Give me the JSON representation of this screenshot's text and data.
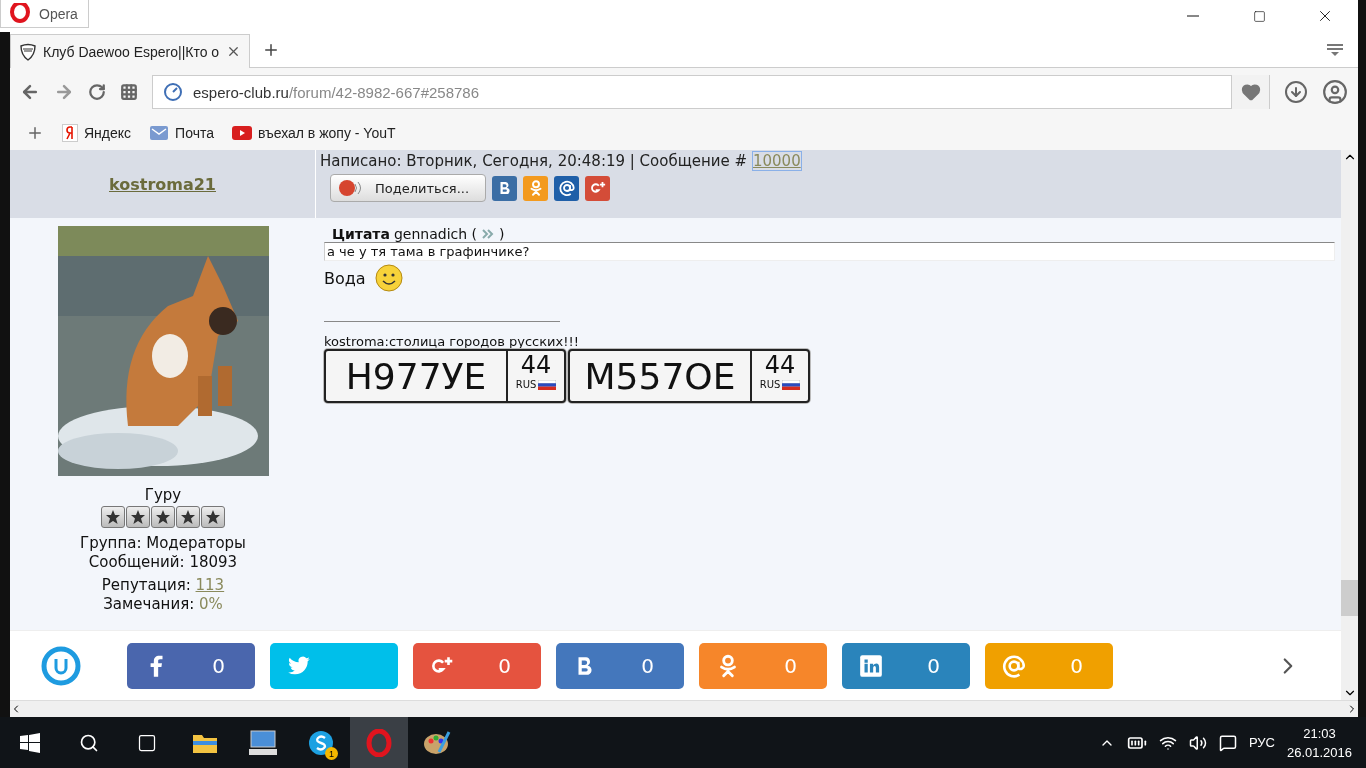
{
  "window": {
    "title": "Opera"
  },
  "tabs": [
    {
      "label": "Клуб Daewoo Espero||Кто о",
      "selected": true
    }
  ],
  "address": {
    "host": "espero-club.ru",
    "path": "/forum/42-8982-667#258786"
  },
  "bookmarks": [
    {
      "kind": "yandex",
      "label": "Яндекс"
    },
    {
      "kind": "mail",
      "label": "Почта"
    },
    {
      "kind": "youtube",
      "label": "въехал в жопу - YouT"
    }
  ],
  "post": {
    "author": "kostroma21",
    "written": "Написано: Вторник, Сегодня, 20:48:19 | Сообщение #",
    "number": "10000",
    "share_label": "Поделиться...",
    "share_icons": [
      {
        "kind": "vk",
        "color": "#3b6ea5"
      },
      {
        "kind": "ok",
        "color": "#f39a1e"
      },
      {
        "kind": "mail",
        "color": "#1f5fa8"
      },
      {
        "kind": "gplus",
        "color": "#d44c38"
      }
    ],
    "quote_label": "Цитата",
    "quote_author": "gennadich (",
    "quote_close": ")",
    "quote_text": "а че у тя тама в графинчике?",
    "reply": "Вода",
    "signature": "kostroma:столица городов русских!!!",
    "plates": [
      {
        "number": "Н977УЕ",
        "region": "44",
        "country": "RUS"
      },
      {
        "number": "М557ОЕ",
        "region": "44",
        "country": "RUS"
      }
    ],
    "rank": "Гуру",
    "stars": 5,
    "group": "Группа: Модераторы",
    "messages": "Сообщений: 18093",
    "reputation_label": "Репутация:",
    "reputation": "113",
    "warnings_label": "Замечания:",
    "warnings": "0%"
  },
  "share_bar": [
    {
      "kind": "facebook",
      "color": "#4a66ad",
      "count": "0"
    },
    {
      "kind": "twitter",
      "color": "#00bfea"
    },
    {
      "kind": "gplus",
      "color": "#e5533f",
      "count": "0"
    },
    {
      "kind": "vk",
      "color": "#4477bc",
      "count": "0"
    },
    {
      "kind": "ok",
      "color": "#f6862a",
      "count": "0"
    },
    {
      "kind": "linkedin",
      "color": "#2a84bb",
      "count": "0"
    },
    {
      "kind": "mail",
      "color": "#f0a000",
      "count": "0"
    }
  ],
  "taskbar": {
    "language": "РУС",
    "time": "21:03",
    "date": "26.01.2016",
    "skype_badge": "1"
  }
}
